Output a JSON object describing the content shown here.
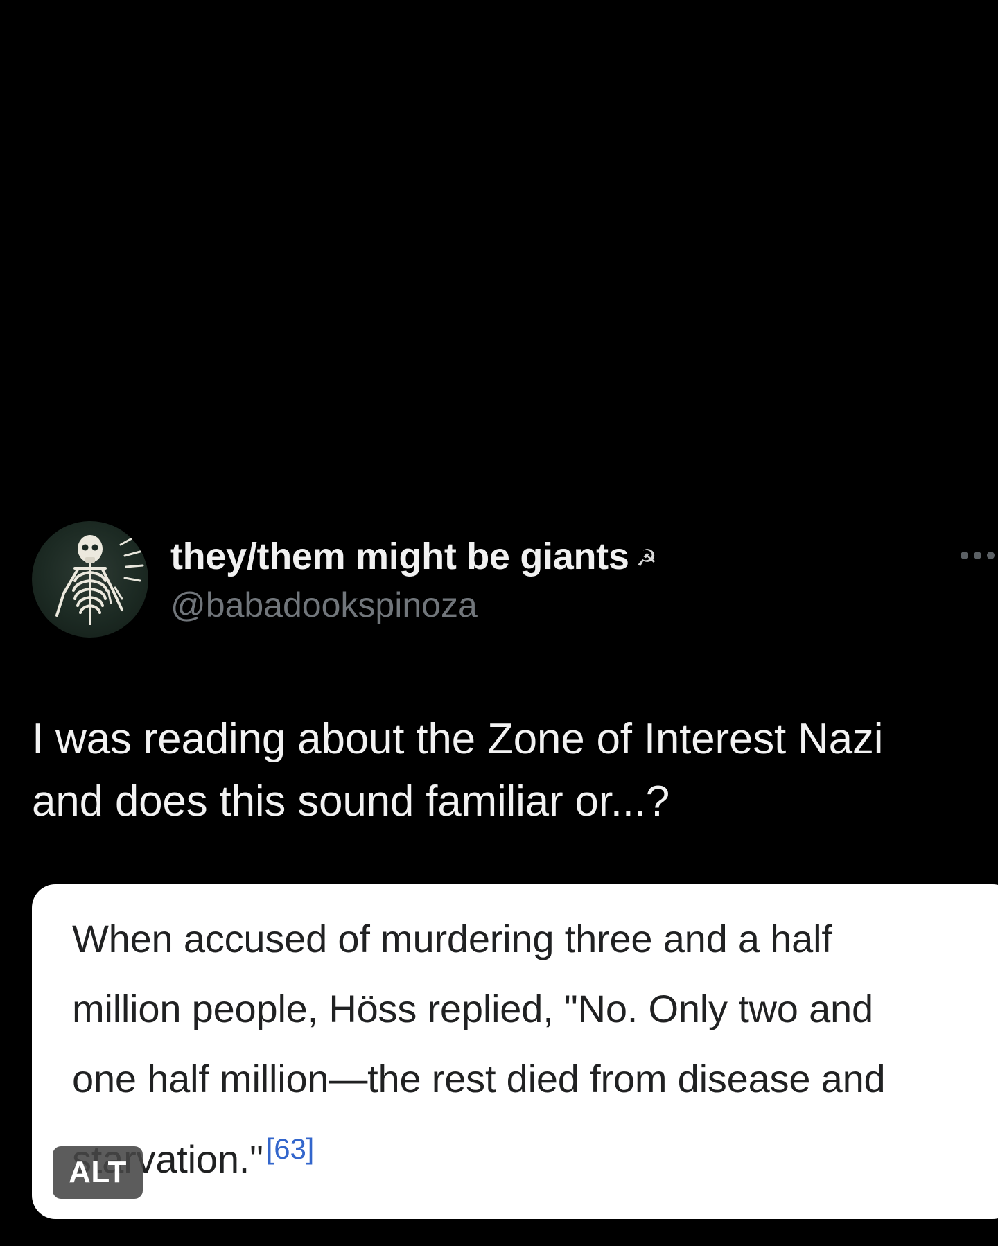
{
  "post": {
    "author": {
      "display_name": "they/them might be giants",
      "name_emoji": "☭",
      "handle": "@babadookspinoza",
      "avatar_icon": "skeleton-illustration"
    },
    "more_icon": "more-dots-icon",
    "text_lines": [
      "I was reading about the Zone of Interest Nazi",
      "and does this sound familiar or...?"
    ],
    "media": {
      "quote_lines": [
        "When accused of murdering three and a half",
        "million people, Höss replied, \"No. Only two and",
        "one half million—the rest died from disease and",
        "starvation.\""
      ],
      "citation": "[63]",
      "alt_badge": "ALT"
    }
  },
  "colors": {
    "background": "#000000",
    "name_text": "#f1f1f1",
    "handle_text": "#71767b",
    "card_background": "#ffffff",
    "quote_text": "#202122",
    "citation_link": "#3366cc"
  }
}
